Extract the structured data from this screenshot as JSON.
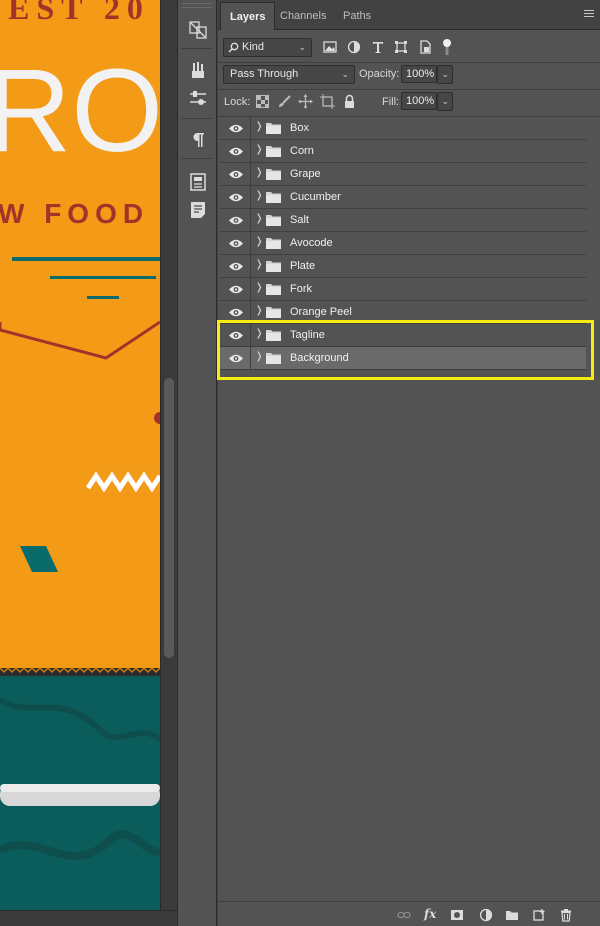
{
  "canvas": {
    "artwork_text_top": "EST 20",
    "artwork_text_big": "RO",
    "artwork_text_sub": "W FOOD",
    "colors": {
      "orange": "#f39a17",
      "teal": "#0a6c6a",
      "red": "#a3322b"
    }
  },
  "icon_column": {
    "icons": [
      "transform-icon",
      "brush-presets-icon",
      "adjust-sliders-icon",
      "paragraph-icon",
      "character-styles-icon",
      "document-notes-icon"
    ]
  },
  "panel": {
    "tabs": [
      {
        "label": "Layers",
        "active": true
      },
      {
        "label": "Channels",
        "active": false
      },
      {
        "label": "Paths",
        "active": false
      }
    ],
    "filter": {
      "kind_label": "Kind"
    },
    "blend_mode": "Pass Through",
    "opacity_label": "Opacity:",
    "opacity_value": "100%",
    "lock_label": "Lock:",
    "fill_label": "Fill:",
    "fill_value": "100%"
  },
  "layers": [
    {
      "name": "Box",
      "selected": false
    },
    {
      "name": "Corn",
      "selected": false
    },
    {
      "name": "Grape",
      "selected": false
    },
    {
      "name": "Cucumber",
      "selected": false
    },
    {
      "name": "Salt",
      "selected": false
    },
    {
      "name": "Avocode",
      "selected": false
    },
    {
      "name": "Plate",
      "selected": false
    },
    {
      "name": "Fork",
      "selected": false
    },
    {
      "name": "Orange Peel",
      "selected": false
    },
    {
      "name": "Tagline",
      "selected": false
    },
    {
      "name": "Background",
      "selected": true
    }
  ],
  "highlight_color": "#f7ec0f"
}
